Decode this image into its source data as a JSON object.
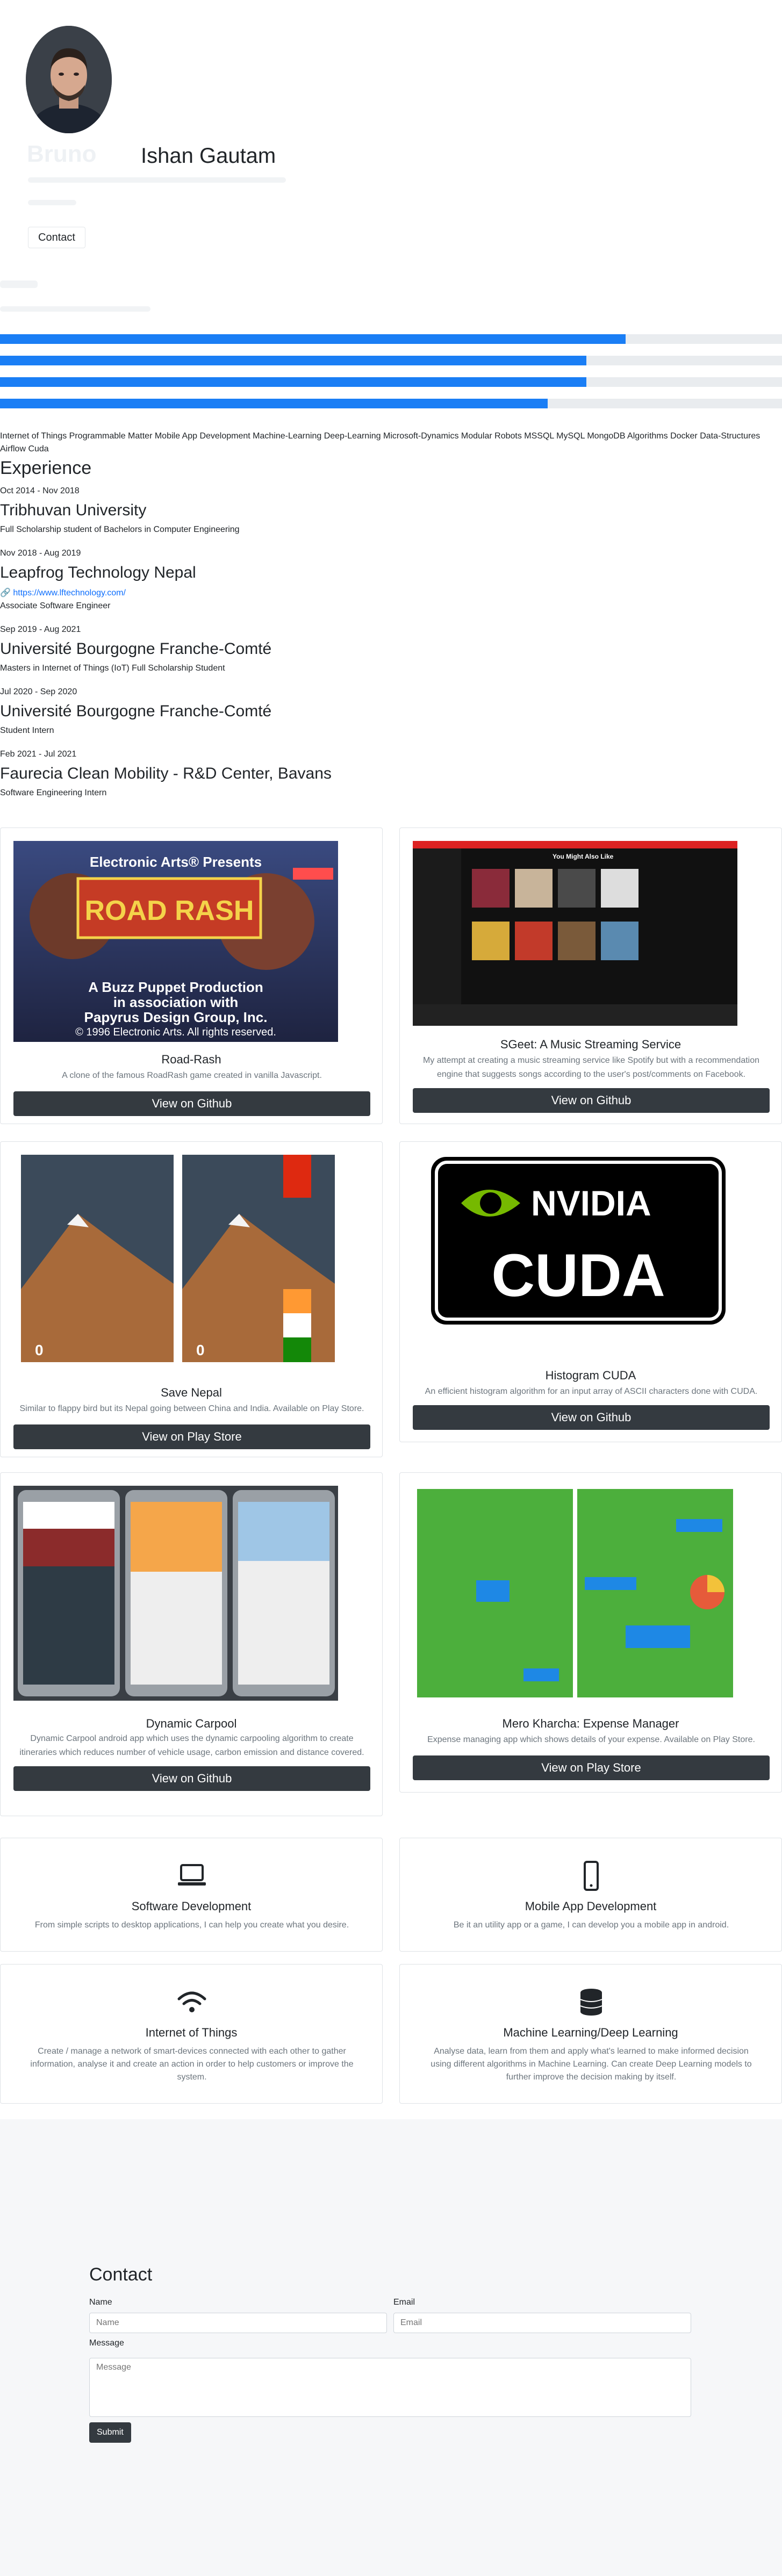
{
  "hero": {
    "name": "Ishan Gautam",
    "contact_button": "Contact"
  },
  "skills": {
    "bars": [
      {
        "level": 0.8
      },
      {
        "level": 0.75
      },
      {
        "level": 0.75
      },
      {
        "level": 0.7
      }
    ],
    "tags": "Internet of Things Programmable Matter Mobile App Development Machine-Learning Deep-Learning Microsoft-Dynamics Modular Robots MSSQL MySQL MongoDB Algorithms Docker Data-Structures Airflow Cuda"
  },
  "experience": {
    "heading": "Experience",
    "jobs": [
      {
        "date": "Oct 2014 - Nov 2018",
        "org": "Tribhuvan University",
        "role": "Full Scholarship student of Bachelors in Computer Engineering"
      },
      {
        "date": "Nov 2018 - Aug 2019",
        "org": "Leapfrog Technology Nepal",
        "link": "https://www.lftechnology.com/",
        "role": "Associate Software Engineer"
      },
      {
        "date": "Sep 2019 - Aug 2021",
        "org": "Université Bourgogne Franche-Comté",
        "role": "Masters in Internet of Things (IoT) Full Scholarship Student"
      },
      {
        "date": "Jul 2020 - Sep 2020",
        "org": "Université Bourgogne Franche-Comté",
        "role": "Student Intern"
      },
      {
        "date": "Feb 2021 - Jul 2021",
        "org": "Faurecia Clean Mobility - R&D Center, Bavans",
        "role": "Software Engineering Intern"
      }
    ]
  },
  "projects": [
    {
      "title": "Road-Rash",
      "desc": "A clone of the famous RoadRash game created in vanilla Javascript.",
      "button": "View on Github",
      "image_text": {
        "line1": "Electronic Arts® Presents",
        "logo": "ROAD RASH",
        "line2": "A Buzz Puppet Production",
        "line3": "in association with",
        "line4": "Papyrus Design Group, Inc.",
        "line5": "© 1996 Electronic Arts. All rights reserved."
      }
    },
    {
      "title": "SGeet: A Music Streaming Service",
      "desc": "My attempt at creating a music streaming service like Spotify but with a recommendation engine that suggests songs according to the user's post/comments on Facebook.",
      "button": "View on Github",
      "image_text": {
        "heading": "You Might Also Like"
      }
    },
    {
      "title": "Save Nepal",
      "desc": "Similar to flappy bird but its Nepal going between China and India. Available on Play Store.",
      "button": "View on Play Store",
      "image_text": {
        "score": "0"
      }
    },
    {
      "title": "Histogram CUDA",
      "desc": "An efficient histogram algorithm for an input array of ASCII characters done with CUDA.",
      "button": "View on Github",
      "image_text": {
        "brand": "NVIDIA",
        "product": "CUDA"
      }
    },
    {
      "title": "Dynamic Carpool",
      "desc": "Dynamic Carpool android app which uses the dynamic carpooling algorithm to create itineraries which reduces number of vehicle usage, carbon emission and distance covered.",
      "button": "View on Github"
    },
    {
      "title": "Mero Kharcha: Expense Manager",
      "desc": "Expense managing app which shows details of your expense. Available on Play Store.",
      "button": "View on Play Store"
    }
  ],
  "services": [
    {
      "name": "Software Development",
      "desc": "From simple scripts to desktop applications, I can help you create what you desire.",
      "icon": "laptop-icon"
    },
    {
      "name": "Mobile App Development",
      "desc": "Be it an utility app or a game, I can develop you a mobile app in android.",
      "icon": "mobile-phone-icon"
    },
    {
      "name": "Internet of Things",
      "desc": "Create / manage a network of smart-devices connected with each other to gather information, analyse it and create an action in order to help customers or improve the system.",
      "icon": "wifi-icon"
    },
    {
      "name": "Machine Learning/Deep Learning",
      "desc": "Analyse data, learn from them and apply what's learned to make informed decision using different algorithms in Machine Learning. Can create Deep Learning models to further improve the decision making by itself.",
      "icon": "database-icon"
    }
  ],
  "contact": {
    "heading": "Contact",
    "name_label": "Name",
    "name_placeholder": "Name",
    "email_label": "Email",
    "email_placeholder": "Email",
    "message_label": "Message",
    "message_placeholder": "Message",
    "submit": "Submit"
  },
  "colors": {
    "accent": "#1a7ef5",
    "dark_button": "#343a40",
    "link": "#0d6efd"
  }
}
